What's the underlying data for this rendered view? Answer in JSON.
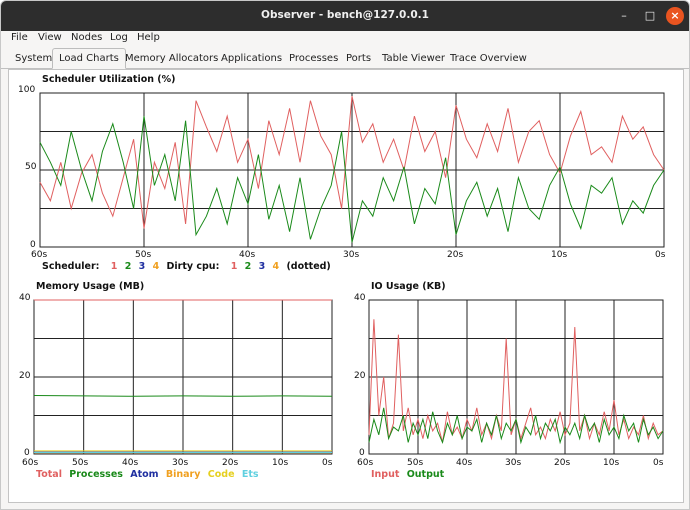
{
  "window": {
    "title": "Observer - bench@127.0.0.1"
  },
  "window_controls": {
    "minimize": "–",
    "maximize": "□",
    "close": "×"
  },
  "menu": [
    "File",
    "View",
    "Nodes",
    "Log",
    "Help"
  ],
  "tabs": [
    "System",
    "Load Charts",
    "Memory Allocators",
    "Applications",
    "Processes",
    "Ports",
    "Table Viewer",
    "Trace Overview"
  ],
  "active_tab": "Load Charts",
  "colors": {
    "s1": "#e06060",
    "s2": "#1a8a1a",
    "s3": "#1f2fa0",
    "s4": "#f0a020",
    "total": "#e06060",
    "processes": "#1a8a1a",
    "atom": "#1f2fa0",
    "binary": "#f0a020",
    "code": "#e6d020",
    "ets": "#60d0e0",
    "input": "#e06060",
    "output": "#1a8a1a"
  },
  "scheduler": {
    "title": "Scheduler Utilization (%)",
    "legend": {
      "scheduler_label": "Scheduler:",
      "dirty_label": "Dirty cpu:",
      "dotted_label": "(dotted)",
      "nums": [
        "1",
        "2",
        "3",
        "4"
      ]
    }
  },
  "memory": {
    "title": "Memory Usage (MB)",
    "legend": [
      "Total",
      "Processes",
      "Atom",
      "Binary",
      "Code",
      "Ets"
    ]
  },
  "io": {
    "title": "IO Usage (KB)",
    "legend": [
      "Input",
      "Output"
    ]
  },
  "chart_data": [
    {
      "type": "line",
      "title": "Scheduler Utilization (%)",
      "xlabel": "",
      "ylabel": "",
      "x_ticks": [
        "60s",
        "50s",
        "40s",
        "30s",
        "20s",
        "10s",
        "0s"
      ],
      "y_ticks": [
        "0",
        "50",
        "100"
      ],
      "ylim": [
        0,
        100
      ],
      "grid": true,
      "x": [
        60,
        59,
        58,
        57,
        56,
        55,
        54,
        53,
        52,
        51,
        50,
        49,
        48,
        47,
        46,
        45,
        44,
        43,
        42,
        41,
        40,
        39,
        38,
        37,
        36,
        35,
        34,
        33,
        32,
        31,
        30,
        29,
        28,
        27,
        26,
        25,
        24,
        23,
        22,
        21,
        20,
        19,
        18,
        17,
        16,
        15,
        14,
        13,
        12,
        11,
        10,
        9,
        8,
        7,
        6,
        5,
        4,
        3,
        2,
        1,
        0
      ],
      "series": [
        {
          "name": "1",
          "values": [
            42,
            30,
            55,
            25,
            48,
            60,
            35,
            20,
            45,
            70,
            12,
            55,
            38,
            68,
            15,
            95,
            78,
            62,
            85,
            55,
            70,
            38,
            82,
            60,
            90,
            55,
            95,
            72,
            60,
            25,
            98,
            68,
            80,
            55,
            70,
            50,
            85,
            62,
            75,
            45,
            92,
            70,
            58,
            80,
            62,
            90,
            55,
            75,
            82,
            60,
            48,
            72,
            88,
            60,
            65,
            55,
            85,
            70,
            78,
            60,
            50
          ]
        },
        {
          "name": "2",
          "values": [
            68,
            55,
            40,
            75,
            50,
            30,
            62,
            80,
            55,
            25,
            85,
            40,
            60,
            30,
            82,
            8,
            20,
            38,
            15,
            45,
            28,
            60,
            18,
            40,
            10,
            45,
            5,
            25,
            40,
            75,
            3,
            30,
            20,
            45,
            30,
            52,
            15,
            38,
            28,
            58,
            8,
            30,
            42,
            20,
            38,
            10,
            45,
            25,
            18,
            40,
            52,
            28,
            12,
            40,
            35,
            45,
            15,
            30,
            22,
            40,
            50
          ]
        },
        {
          "name": "3",
          "values": []
        },
        {
          "name": "4",
          "values": []
        }
      ]
    },
    {
      "type": "line",
      "title": "Memory Usage (MB)",
      "x_ticks": [
        "60s",
        "50s",
        "40s",
        "30s",
        "20s",
        "10s",
        "0s"
      ],
      "y_ticks": [
        "0",
        "20",
        "40"
      ],
      "ylim": [
        0,
        40
      ],
      "grid": true,
      "x": [
        60,
        50,
        40,
        30,
        20,
        10,
        0
      ],
      "series": [
        {
          "name": "Total",
          "values": [
            40,
            40,
            40,
            40,
            40,
            40,
            40
          ]
        },
        {
          "name": "Processes",
          "values": [
            15.2,
            15.1,
            15.0,
            15.1,
            15.0,
            15.1,
            15.0
          ]
        },
        {
          "name": "Atom",
          "values": [
            0.5,
            0.5,
            0.5,
            0.5,
            0.5,
            0.5,
            0.5
          ]
        },
        {
          "name": "Binary",
          "values": [
            0.3,
            0.3,
            0.3,
            0.3,
            0.3,
            0.3,
            0.3
          ]
        },
        {
          "name": "Code",
          "values": [
            0.8,
            0.8,
            0.8,
            0.8,
            0.8,
            0.8,
            0.8
          ]
        },
        {
          "name": "Ets",
          "values": [
            0.4,
            0.4,
            0.4,
            0.4,
            0.4,
            0.4,
            0.4
          ]
        }
      ]
    },
    {
      "type": "line",
      "title": "IO Usage (KB)",
      "x_ticks": [
        "60s",
        "50s",
        "40s",
        "30s",
        "20s",
        "10s",
        "0s"
      ],
      "y_ticks": [
        "0",
        "20",
        "40"
      ],
      "ylim": [
        0,
        40
      ],
      "grid": true,
      "x": [
        60,
        59,
        58,
        57,
        56,
        55,
        54,
        53,
        52,
        51,
        50,
        49,
        48,
        47,
        46,
        45,
        44,
        43,
        42,
        41,
        40,
        39,
        38,
        37,
        36,
        35,
        34,
        33,
        32,
        31,
        30,
        29,
        28,
        27,
        26,
        25,
        24,
        23,
        22,
        21,
        20,
        19,
        18,
        17,
        16,
        15,
        14,
        13,
        12,
        11,
        10,
        9,
        8,
        7,
        6,
        5,
        4,
        3,
        2,
        1,
        0
      ],
      "series": [
        {
          "name": "Input",
          "values": [
            5,
            35,
            10,
            20,
            4,
            8,
            31,
            6,
            12,
            5,
            9,
            4,
            10,
            6,
            8,
            3,
            11,
            5,
            7,
            4,
            9,
            6,
            12,
            5,
            8,
            4,
            10,
            6,
            30,
            5,
            9,
            4,
            8,
            12,
            5,
            7,
            4,
            9,
            6,
            11,
            5,
            8,
            33,
            6,
            10,
            4,
            8,
            5,
            11,
            6,
            14,
            5,
            9,
            4,
            7,
            5,
            10,
            4,
            8,
            5,
            6
          ]
        },
        {
          "name": "Output",
          "values": [
            3,
            9,
            5,
            12,
            4,
            7,
            6,
            10,
            3,
            8,
            5,
            9,
            4,
            11,
            6,
            3,
            8,
            5,
            10,
            4,
            7,
            6,
            9,
            3,
            8,
            5,
            10,
            4,
            8,
            6,
            9,
            3,
            7,
            5,
            10,
            4,
            8,
            6,
            9,
            3,
            7,
            5,
            8,
            4,
            10,
            6,
            8,
            3,
            9,
            5,
            7,
            4,
            10,
            6,
            8,
            3,
            9,
            5,
            7,
            4,
            6
          ]
        }
      ]
    }
  ]
}
